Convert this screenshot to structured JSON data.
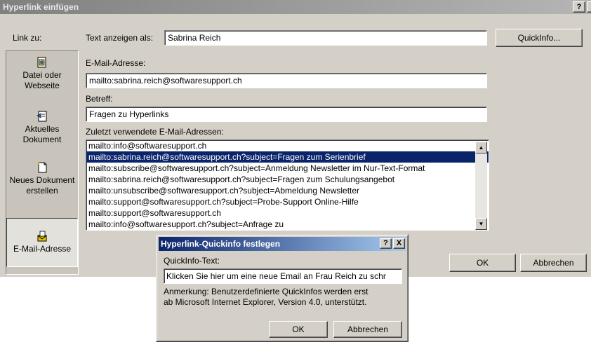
{
  "window": {
    "title": "Hyperlink einfügen",
    "help_btn": "?",
    "close_btn": "X"
  },
  "linkto": {
    "label": "Link zu:",
    "items": [
      {
        "label": "Datei oder Webseite",
        "icon": "web-page-icon"
      },
      {
        "label": "Aktuelles Dokument",
        "icon": "document-icon"
      },
      {
        "label": "Neues Dokument erstellen",
        "icon": "new-document-icon"
      },
      {
        "label": "E-Mail-Adresse",
        "icon": "email-icon",
        "selected": true
      }
    ]
  },
  "display_text": {
    "label": "Text anzeigen als:",
    "value": "Sabrina Reich"
  },
  "quickinfo_button": "QuickInfo...",
  "email": {
    "label": "E-Mail-Adresse:",
    "value": "mailto:sabrina.reich@softwaresupport.ch"
  },
  "subject": {
    "label": "Betreff:",
    "value": "Fragen zu Hyperlinks"
  },
  "recent": {
    "label": "Zuletzt verwendete E-Mail-Adressen:",
    "items": [
      "mailto:info@softwaresupport.ch",
      "mailto:sabrina.reich@softwaresupport.ch?subject=Fragen zum Serienbrief",
      "mailto:subscribe@softwaresupport.ch?subject=Anmeldung Newsletter im Nur-Text-Format",
      "mailto:sabrina.reich@softwaresupport.ch?subject=Fragen zum Schulungsangebot",
      "mailto:unsubscribe@softwaresupport.ch?subject=Abmeldung Newsletter",
      "mailto:support@softwaresupport.ch?subject=Probe-Support Online-Hilfe",
      "mailto:support@softwaresupport.ch",
      "mailto:info@softwaresupport.ch?subject=Anfrage zu"
    ],
    "selected_index": 1
  },
  "ok": "OK",
  "cancel": "Abbrechen",
  "quickinfo_dialog": {
    "title": "Hyperlink-Quickinfo festlegen",
    "help_btn": "?",
    "close_btn": "X",
    "label": "QuickInfo-Text:",
    "value": "Klicken Sie hier um eine neue Email an Frau Reich zu schr",
    "note_line1": "Anmerkung: Benutzerdefinierte QuickInfos werden erst",
    "note_line2": "ab Microsoft Internet Explorer, Version 4.0, unterstützt.",
    "ok": "OK",
    "cancel": "Abbrechen"
  }
}
